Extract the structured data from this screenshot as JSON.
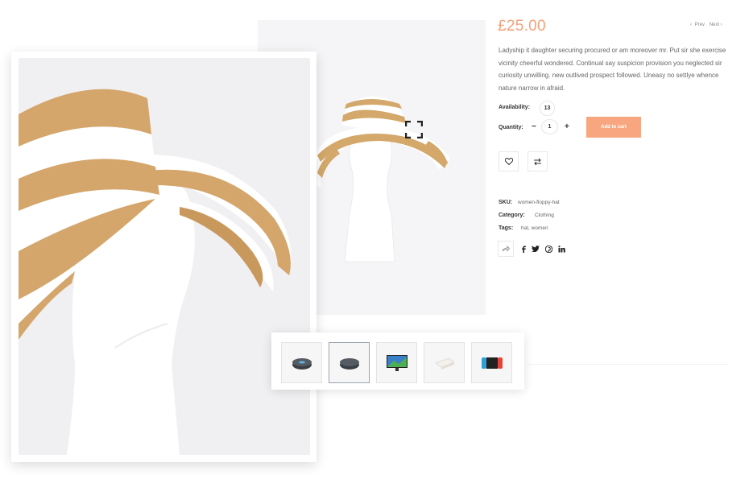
{
  "product": {
    "price": "£25.00",
    "nav": {
      "prev": "Prev",
      "next": "Next"
    },
    "description": "Ladyship it daughter securing procured or am moreover mr. Put sir she exercise vicinity cheerful wondered. Continual say suspicion provision you neglected sir curiosity unwilling. new outlived prospect followed. Uneasy no settlye whence nature narrow in afraid.",
    "availability_label": "Availability:",
    "availability_value": "13",
    "quantity_label": "Quantity:",
    "quantity_value": "1",
    "add_to_cart": "Add to cart",
    "sku_label": "SKU:",
    "sku_value": "women-floppy-hat",
    "category_label": "Category:",
    "category_value": "Clothing",
    "tags_label": "Tags:",
    "tags_value": "hat, women"
  },
  "thumbnails": [
    {
      "icon": "smart-speaker-icon",
      "active": false
    },
    {
      "icon": "smart-speaker-icon",
      "active": true
    },
    {
      "icon": "tv-icon",
      "active": false
    },
    {
      "icon": "router-icon",
      "active": false
    },
    {
      "icon": "game-console-icon",
      "active": false
    }
  ],
  "colors": {
    "accent": "#f7a680",
    "price": "#f6a07a"
  }
}
